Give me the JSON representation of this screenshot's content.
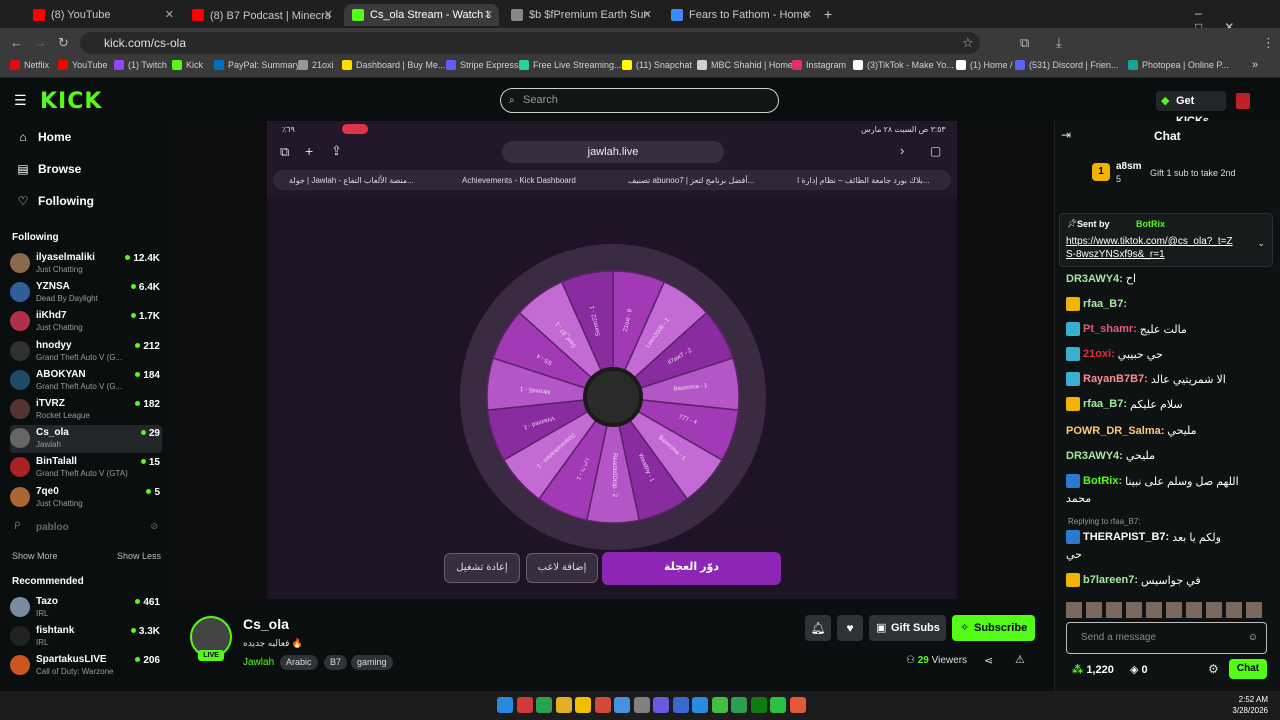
{
  "browser": {
    "tabs": [
      {
        "label": "(8) YouTube",
        "color": "#ff0000"
      },
      {
        "label": "(8) B7 Podcast | Minecraft | ٩",
        "color": "#ff0000"
      },
      {
        "label": "Cs_ola Stream - Watch Live",
        "color": "#53fc18"
      },
      {
        "label": "$b $fPremium Earth Survival $",
        "color": "#888888"
      },
      {
        "label": "Fears to Fathom - Home Alone",
        "color": "#3c8cff"
      }
    ],
    "url": "kick.com/cs-ola",
    "bookmarks": [
      {
        "label": "Netflix",
        "color": "#e50914"
      },
      {
        "label": "YouTube",
        "color": "#ff0000"
      },
      {
        "label": "(1) Twitch",
        "color": "#9146ff"
      },
      {
        "label": "Kick",
        "color": "#53fc18"
      },
      {
        "label": "PayPal: Summary",
        "color": "#0070ba"
      },
      {
        "label": "21oxi",
        "color": "#999999"
      },
      {
        "label": "Dashboard | Buy Me...",
        "color": "#ffdd00"
      },
      {
        "label": "Stripe Express",
        "color": "#635bff"
      },
      {
        "label": "Free Live Streaming...",
        "color": "#2ad4a0"
      },
      {
        "label": "(11) Snapchat",
        "color": "#fffc00"
      },
      {
        "label": "MBC Shahid | Home",
        "color": "#d0d0d0"
      },
      {
        "label": "Instagram",
        "color": "#e1306c"
      },
      {
        "label": "(3)TikTok - Make Yo...",
        "color": "#ffffff"
      },
      {
        "label": "(1) Home / X",
        "color": "#ffffff"
      },
      {
        "label": "(531) Discord | Frien...",
        "color": "#5865f2"
      },
      {
        "label": "Photopea | Online P...",
        "color": "#18a497"
      }
    ]
  },
  "header": {
    "logo": "KICK",
    "search_placeholder": "Search",
    "get_kicks": "Get KICKs"
  },
  "sidebar": {
    "nav": [
      {
        "label": "Home",
        "icon": "home-icon",
        "glyph": "⌂"
      },
      {
        "label": "Browse",
        "icon": "browse-icon",
        "glyph": "▤"
      },
      {
        "label": "Following",
        "icon": "heart-icon",
        "glyph": "♡"
      }
    ],
    "following_title": "Following",
    "following": [
      {
        "name": "ilyaselmaliki",
        "game": "Just Chatting",
        "viewers": "12.4K",
        "color": "#8a6a4a"
      },
      {
        "name": "YZNSA",
        "game": "Dead By Daylight",
        "viewers": "6.4K",
        "color": "#2d5f9a"
      },
      {
        "name": "iiKhd7",
        "game": "Just Chatting",
        "viewers": "1.7K",
        "color": "#b0304a"
      },
      {
        "name": "hnodyy",
        "game": "Grand Theft Auto V (G...",
        "viewers": "212",
        "color": "#303030"
      },
      {
        "name": "ABOKYAN",
        "game": "Grand Theft Auto V (G...",
        "viewers": "184",
        "color": "#1e4a6a"
      },
      {
        "name": "iTVRZ",
        "game": "Rocket League",
        "viewers": "182",
        "color": "#553333"
      },
      {
        "name": "Cs_ola",
        "game": "Jawlah",
        "viewers": "29",
        "color": "#666666"
      },
      {
        "name": "BinTalall",
        "game": "Grand Theft Auto V (GTA)",
        "viewers": "15",
        "color": "#aa2222"
      },
      {
        "name": "7qe0",
        "game": "Just Chatting",
        "viewers": "5",
        "color": "#aa6633"
      }
    ],
    "offline": "pabloo",
    "show_more": "Show More",
    "show_less": "Show Less",
    "recommended_title": "Recommended",
    "recommended": [
      {
        "name": "Tazo",
        "game": "IRL",
        "viewers": "461",
        "color": "#7a8aa0"
      },
      {
        "name": "fishtank",
        "game": "IRL",
        "viewers": "3.3K",
        "color": "#222222"
      },
      {
        "name": "SpartakusLIVE",
        "game": "Call of Duty: Warzone",
        "viewers": "206",
        "color": "#cc5522"
      }
    ]
  },
  "stream": {
    "phone_status_left": "٣:٥٣ ص   السبت ٢٨ مارس",
    "phone_status_right": "٪٦٩",
    "site": "jawlah.live",
    "phone_tabs": [
      "بلاك بورد جامعة الطائف – نظام إدارة ا...",
      "تصنيف abunoo7 | أفضل برنامج لتعز...",
      "Achievements - Kick Dashboard",
      "جولة | Jawlah - منصة الألعاب التفاع..."
    ],
    "wheel_labels": [
      "21oxi - 8",
      "Leen2006 - 1",
      "Il7awT - 2",
      "Basooma - 1",
      "777 - 4",
      "Basooma - 1",
      "Wealthy - 1",
      "ReactedDrop - 2",
      "r.r^.^r - 1",
      "2ioaneadcanes - 1",
      "VVaxxed - 1",
      "Mrsm45 - 1",
      "SS - 4",
      "Saef_87 - 1",
      "Sonm22 - 1"
    ],
    "btn_restart": "إعادة تشغيل",
    "btn_add_player": "إضافة لاعب",
    "btn_spin": "دوّر العجلة"
  },
  "channel": {
    "name": "Cs_ola",
    "title": "فعاليه جديده 🔥",
    "live": "LIVE",
    "category": "Jawlah",
    "tags": [
      "Arabic",
      "B7",
      "gaming"
    ],
    "gift_subs": "Gift Subs",
    "subscribe": "Subscribe",
    "viewers": "29",
    "viewers_label": "Viewers"
  },
  "chat": {
    "title": "Chat",
    "gift_user": "a8sm",
    "gift_count": "5",
    "gift_text": "Gift 1 sub to take 2nd",
    "pinned_by": "Sent by",
    "pinned_user": "BotRix",
    "pinned_link": "https://www.tiktok.com/@cs_ola?_t=ZS-8wszYNSxf9s&_r=1",
    "messages": [
      {
        "user": "DR3AWY4",
        "color": "#a8e6a0",
        "text": "اح"
      },
      {
        "user": "rfaa_B7",
        "color": "#a8e6a0",
        "text": ""
      },
      {
        "user": "Pt_shamr",
        "color": "#e05a7a",
        "text": "مالت عليج"
      },
      {
        "user": "21oxi",
        "color": "#e0303a",
        "text": "حي حبيبي"
      },
      {
        "user": "RayanB7B7",
        "color": "#ff8a8a",
        "text": "الا شمريتيي عالد"
      },
      {
        "user": "rfaa_B7",
        "color": "#a8e6a0",
        "text": "سلام عليكم"
      },
      {
        "user": "POWR_DR_Salma",
        "color": "#ffc878",
        "text": "مليحي"
      },
      {
        "user": "DR3AWY4",
        "color": "#a8e6a0",
        "text": "مليحي"
      },
      {
        "user": "BotRix",
        "color": "#53fc18",
        "text": "اللهم صل وسلم على نبينا"
      },
      {
        "user": "",
        "color": "#ffffff",
        "text": "محمد"
      },
      {
        "user": "THERAPIST_B7",
        "color": "#ffffff",
        "text": "ولكم يا بعد"
      },
      {
        "user": "",
        "color": "#ffffff",
        "text": "حي"
      },
      {
        "user": "b7lareen7",
        "color": "#a8e6a0",
        "text": "في جواسيس"
      }
    ],
    "reply_label": "Replying to rfaa_B7:",
    "send_placeholder": "Send a message",
    "points": "1,220",
    "count": "0",
    "chat_btn": "Chat"
  },
  "taskbar": {
    "time": "2:52 AM",
    "date": "3/28/2026"
  }
}
